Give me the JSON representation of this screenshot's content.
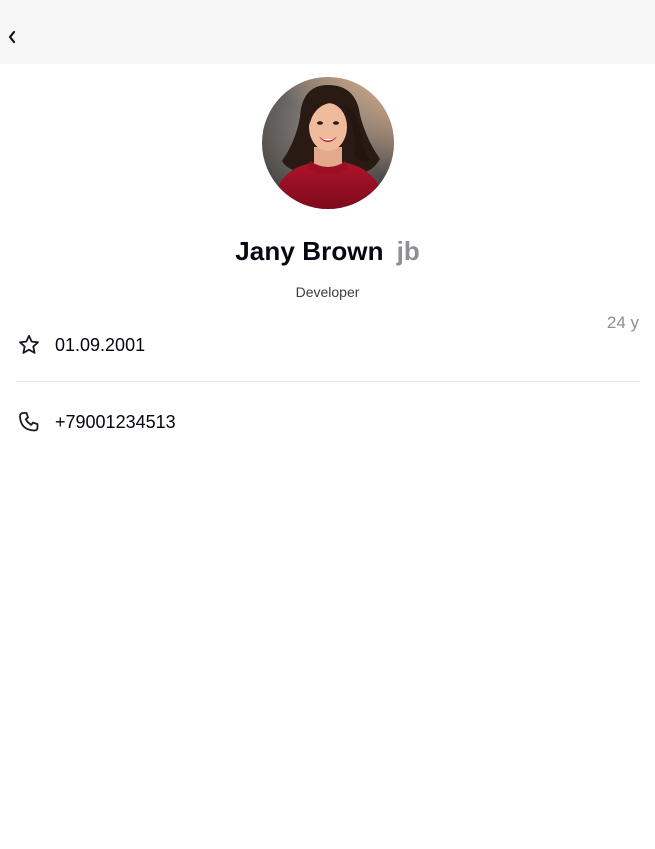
{
  "profile": {
    "name": "Jany Brown",
    "nickname": "jb",
    "position": "Developer",
    "age": "24 y",
    "birthday": "01.09.2001",
    "phone": "+79001234513"
  },
  "icons": {
    "back": "chevron-left-icon",
    "birthday": "star-icon",
    "phone": "phone-icon"
  },
  "colors": {
    "topbar": "#f6f6f6",
    "text_primary": "#050510",
    "text_secondary": "#8e8e93",
    "divider": "#e6e6ea"
  }
}
